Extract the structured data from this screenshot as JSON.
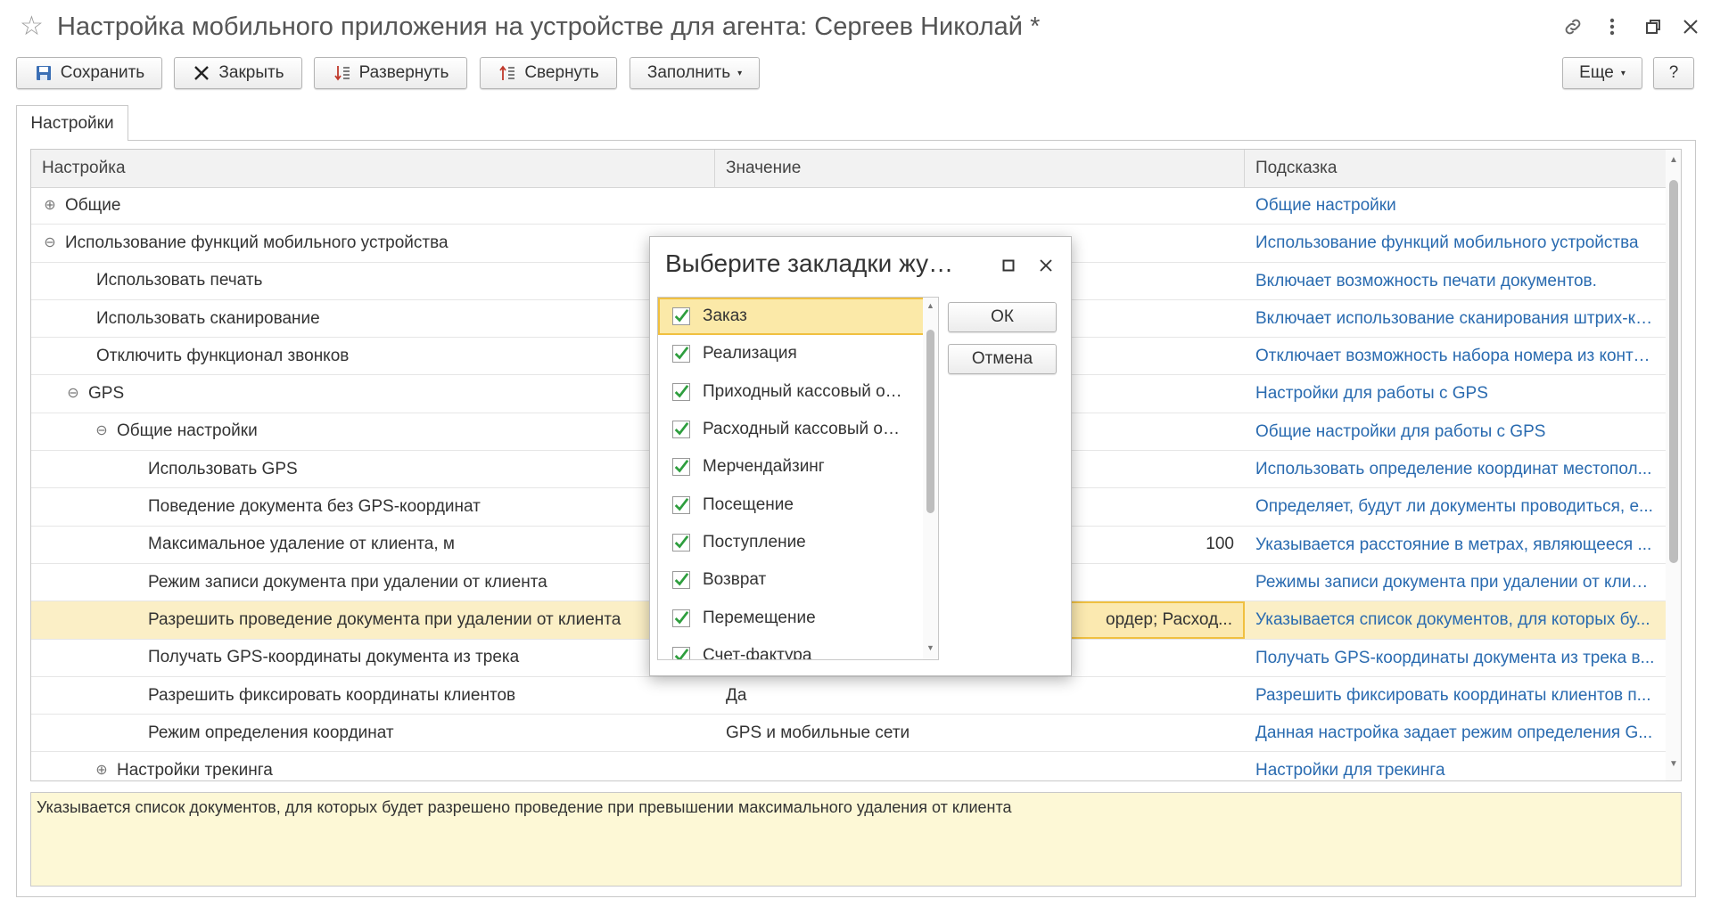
{
  "window": {
    "title": "Настройка мобильного приложения на устройстве для агента: Сергеев Николай *"
  },
  "toolbar": {
    "save": "Сохранить",
    "close": "Закрыть",
    "expand": "Развернуть",
    "collapse": "Свернуть",
    "fill": "Заполнить",
    "more": "Еще",
    "help": "?"
  },
  "tabs": {
    "settings": "Настройки"
  },
  "table": {
    "headers": {
      "setting": "Настройка",
      "value": "Значение",
      "hint": "Подсказка"
    },
    "rows": [
      {
        "name": "Общие",
        "value": "",
        "hint": "Общие настройки"
      },
      {
        "name": "Использование функций мобильного устройства",
        "value": "",
        "hint": "Использование функций мобильного устройства"
      },
      {
        "name": "Использовать печать",
        "value": "",
        "hint": "Включает возможность печати документов."
      },
      {
        "name": "Использовать сканирование",
        "value": "",
        "hint": "Включает использование сканирования штрих-ко..."
      },
      {
        "name": "Отключить функционал звонков",
        "value": "",
        "hint": "Отключает возможность набора номера из конте..."
      },
      {
        "name": "GPS",
        "value": "",
        "hint": "Настройки для работы с GPS"
      },
      {
        "name": "Общие настройки",
        "value": "",
        "hint": "Общие настройки для работы с GPS"
      },
      {
        "name": "Использовать GPS",
        "value": "",
        "hint": "Использовать определение координат местопол..."
      },
      {
        "name": "Поведение документа без GPS-координат",
        "value": "",
        "hint": "Определяет, будут ли документы проводиться, е..."
      },
      {
        "name": "Максимальное удаление от клиента, м",
        "value": "100",
        "hint": "Указывается расстояние в метрах, являющееся ..."
      },
      {
        "name": "Режим записи документа при удалении от клиента",
        "value": "",
        "hint": "Режимы записи документа при удалении от клиен..."
      },
      {
        "name": "Разрешить проведение документа при удалении от клиента",
        "value": "ордер; Расход...",
        "hint": "Указывается список документов, для которых бу..."
      },
      {
        "name": "Получать GPS-координаты документа из трека",
        "value": "",
        "hint": "Получать GPS-координаты документа из трека в..."
      },
      {
        "name": "Разрешить фиксировать координаты клиентов",
        "value": "Да",
        "hint": "Разрешить фиксировать координаты клиентов п..."
      },
      {
        "name": "Режим определения координат",
        "value": "GPS и мобильные сети",
        "hint": "Данная настройка задает режим определения G..."
      },
      {
        "name": "Настройки трекинга",
        "value": "",
        "hint": "Настройки для трекинга"
      }
    ]
  },
  "hint_area": {
    "text": "Указывается список документов, для которых будет разрешено проведение при превышении максимального удаления от клиента"
  },
  "dialog": {
    "title": "Выберите закладки жу…",
    "ok": "ОК",
    "cancel": "Отмена",
    "items": [
      {
        "label": "Заказ",
        "checked": true
      },
      {
        "label": "Реализация",
        "checked": true
      },
      {
        "label": "Приходный кассовый о…",
        "checked": true
      },
      {
        "label": "Расходный кассовый о…",
        "checked": true
      },
      {
        "label": "Мерчендайзинг",
        "checked": true
      },
      {
        "label": "Посещение",
        "checked": true
      },
      {
        "label": "Поступление",
        "checked": true
      },
      {
        "label": "Возврат",
        "checked": true
      },
      {
        "label": "Перемещение",
        "checked": true
      },
      {
        "label": "Счет-фактура",
        "checked": true
      }
    ]
  },
  "colors": {
    "link": "#2a6bb0",
    "selected_row": "#fbefc6",
    "hint_background": "#fdf8d6",
    "checkmark": "#2e9e3e"
  }
}
